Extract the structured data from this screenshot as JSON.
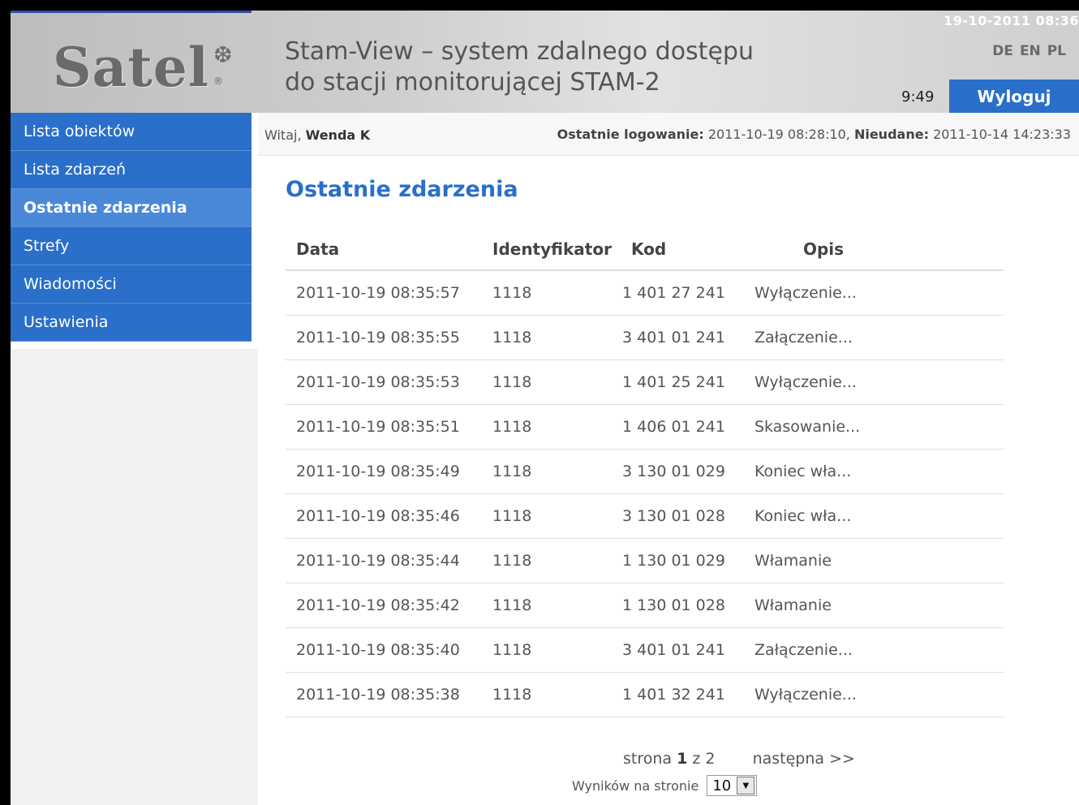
{
  "header": {
    "logo_text": "Satel",
    "logo_mark": "❆",
    "logo_reg": "®",
    "title_line1": "Stam-View – system zdalnego dostępu",
    "title_line2": "do stacji monitorującej STAM-2",
    "date": "19-10-2011 08:36",
    "languages": [
      "DE",
      "EN",
      "PL"
    ],
    "timer": "9:49",
    "logout_label": "Wyloguj"
  },
  "sidebar": {
    "items": [
      {
        "label": "Lista obiektów",
        "active": false
      },
      {
        "label": "Lista zdarzeń",
        "active": false
      },
      {
        "label": "Ostatnie zdarzenia",
        "active": true
      },
      {
        "label": "Strefy",
        "active": false
      },
      {
        "label": "Wiadomości",
        "active": false
      },
      {
        "label": "Ustawienia",
        "active": false
      }
    ]
  },
  "welcome": {
    "greeting": "Witaj,",
    "user": "Wenda K",
    "last_login_label": "Ostatnie logowanie:",
    "last_login_value": "2011-10-19 08:28:10,",
    "failed_label": "Nieudane:",
    "failed_value": "2011-10-14 14:23:33"
  },
  "page_title": "Ostatnie zdarzenia",
  "table": {
    "headers": [
      "Data",
      "Identyfikator",
      "Kod",
      "Opis"
    ],
    "rows": [
      [
        "2011-10-19 08:35:57",
        "1118",
        "1 401 27 241",
        "Wyłączenie..."
      ],
      [
        "2011-10-19 08:35:55",
        "1118",
        "3 401 01 241",
        "Załączenie..."
      ],
      [
        "2011-10-19 08:35:53",
        "1118",
        "1 401 25 241",
        "Wyłączenie..."
      ],
      [
        "2011-10-19 08:35:51",
        "1118",
        "1 406 01 241",
        "Skasowanie..."
      ],
      [
        "2011-10-19 08:35:49",
        "1118",
        "3 130 01 029",
        "Koniec wła..."
      ],
      [
        "2011-10-19 08:35:46",
        "1118",
        "3 130 01 028",
        "Koniec wła..."
      ],
      [
        "2011-10-19 08:35:44",
        "1118",
        "1 130 01 029",
        "Włamanie"
      ],
      [
        "2011-10-19 08:35:42",
        "1118",
        "1 130 01 028",
        "Włamanie"
      ],
      [
        "2011-10-19 08:35:40",
        "1118",
        "3 401 01 241",
        "Załączenie..."
      ],
      [
        "2011-10-19 08:35:38",
        "1118",
        "1 401 32 241",
        "Wyłączenie..."
      ]
    ]
  },
  "pager": {
    "page_word": "strona",
    "current": "1",
    "of_word": "z",
    "total": "2",
    "next_label": "następna >>",
    "per_page_label": "Wyników na stronie",
    "per_page_value": "10"
  },
  "colors": {
    "accent": "#2a6fca",
    "nav_active": "#4a88d8"
  }
}
